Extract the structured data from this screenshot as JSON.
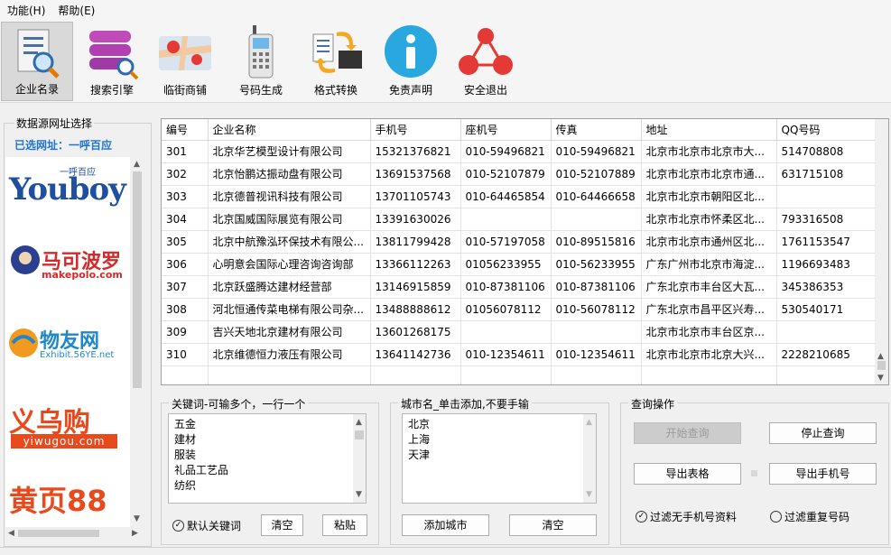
{
  "menu": [
    "功能(H)",
    "帮助(E)"
  ],
  "toolbar": [
    {
      "label": "企业名录",
      "icon": "document-search-icon",
      "active": true
    },
    {
      "label": "搜索引擎",
      "icon": "database-search-icon"
    },
    {
      "label": "临街商铺",
      "icon": "map-pin-icon"
    },
    {
      "label": "号码生成",
      "icon": "phone-icon"
    },
    {
      "label": "格式转换",
      "icon": "convert-icon"
    },
    {
      "label": "免责声明",
      "icon": "info-icon"
    },
    {
      "label": "安全退出",
      "icon": "exit-network-icon"
    }
  ],
  "source": {
    "title": "数据源网址选择",
    "selected": "已选网址：一呼百应",
    "logos": [
      {
        "name": "youboy",
        "text": "Youboy",
        "small": "一呼百应"
      },
      {
        "name": "makepolo",
        "text": "马可波罗",
        "small": "makepolo.com"
      },
      {
        "name": "exhibit",
        "text": "物友网",
        "small": "Exhibit.56YE.net"
      },
      {
        "name": "yiwugou",
        "text": "义乌购",
        "small": "yiwugou.com"
      },
      {
        "name": "huangye88",
        "text": "黄页88",
        "small": ""
      }
    ]
  },
  "table": {
    "columns": [
      "编号",
      "企业名称",
      "手机号",
      "座机号",
      "传真",
      "地址",
      "QQ号码"
    ],
    "rows": [
      [
        "301",
        "北京华艺模型设计有限公司",
        "15321376821",
        "010-59496821",
        "010-59496821",
        "北京市北京市北京市大...",
        "514708808"
      ],
      [
        "302",
        "北京怡鹏达振动盘有限公司",
        "13691537568",
        "010-52107879",
        "010-52107889",
        "北京市北京市北京市通...",
        "631715108"
      ],
      [
        "303",
        "北京德普视讯科技有限公司",
        "13701105743",
        "010-64465854",
        "010-64466658",
        "北京市北京市朝阳区北...",
        ""
      ],
      [
        "304",
        "北京国威国际展览有限公司",
        "13391630026",
        "",
        "",
        "北京市北京市怀柔区北...",
        "793316508"
      ],
      [
        "305",
        "北京中航豫泓环保技术有限公...",
        "13811799428",
        "010-57197058",
        "010-89515816",
        "北京市北京市通州区北...",
        "1761153547"
      ],
      [
        "306",
        "心明意会国际心理咨询咨询部",
        "13366112263",
        "01056233955",
        "010-56233955",
        "广东广州市北京市海淀...",
        "1196693483"
      ],
      [
        "307",
        "北京跃盛腾达建材经营部",
        "13146915859",
        "010-87381106",
        "010-87381106",
        "广东北京市丰台区大瓦...",
        "345386353"
      ],
      [
        "308",
        "河北恒通传菜电梯有限公司杂...",
        "13488888612",
        "01056078112",
        "010-56078112",
        "广东北京市昌平区兴寿...",
        "530540171"
      ],
      [
        "309",
        "吉兴天地北京建材有限公司",
        "13601268175",
        "",
        "",
        "北京市北京市丰台区京...",
        ""
      ],
      [
        "310",
        "北京维德恒力液压有限公司",
        "13641142736",
        "010-12354611",
        "010-12354611",
        "北京市北京市北京大兴...",
        "2228210685"
      ]
    ]
  },
  "keywords": {
    "title": "关键词-可输多个，一行一个",
    "items": [
      "五金",
      "建材",
      "服装",
      "礼品工艺品",
      "纺织"
    ],
    "default_label": "默认关键词",
    "clear_label": "清空",
    "paste_label": "粘贴"
  },
  "cities": {
    "title": "城市名_单击添加,不要手输",
    "items": [
      "北京",
      "上海",
      "天津"
    ],
    "add_label": "添加城市",
    "clear_label": "清空"
  },
  "query": {
    "title": "查询操作",
    "start_label": "开始查询",
    "stop_label": "停止查询",
    "export_table_label": "导出表格",
    "export_phone_label": "导出手机号",
    "filter_no_mobile_label": "过滤无手机号资料",
    "filter_dup_label": "过滤重复号码"
  }
}
